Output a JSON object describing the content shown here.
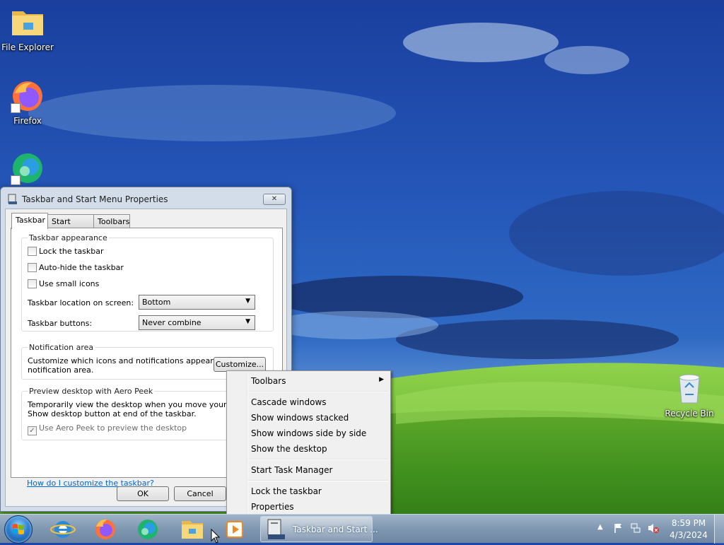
{
  "desktop": {
    "icons": [
      {
        "label": "File Explorer"
      },
      {
        "label": "Firefox"
      },
      {
        "label": ""
      },
      {
        "label": "Recycle Bin"
      }
    ]
  },
  "dialog": {
    "title": "Taskbar and Start Menu Properties",
    "tabs": [
      "Taskbar",
      "Start Menu",
      "Toolbars"
    ],
    "appearance": {
      "title": "Taskbar appearance",
      "lock": "Lock the taskbar",
      "autohide": "Auto-hide the taskbar",
      "small_icons": "Use small icons",
      "location_label": "Taskbar location on screen:",
      "location_value": "Bottom",
      "buttons_label": "Taskbar buttons:",
      "buttons_value": "Never combine"
    },
    "notification": {
      "title": "Notification area",
      "text1": "Customize which icons and notifications appear in the",
      "text2": "notification area.",
      "customize": "Customize..."
    },
    "aero": {
      "title": "Preview desktop with Aero Peek",
      "text1": "Temporarily view the desktop when you move your mouse",
      "text2": "Show desktop button at end of the taskbar.",
      "checkbox": "Use Aero Peek to preview the desktop"
    },
    "help_link": "How do I customize the taskbar?",
    "ok": "OK",
    "cancel": "Cancel"
  },
  "context_menu": {
    "items": [
      "Toolbars",
      "Cascade windows",
      "Show windows stacked",
      "Show windows side by side",
      "Show the desktop",
      "Start Task Manager",
      "Lock the taskbar",
      "Properties"
    ]
  },
  "taskbar": {
    "active_window": "Taskbar and Start ...",
    "time": "8:59 PM",
    "date": "4/3/2024"
  }
}
